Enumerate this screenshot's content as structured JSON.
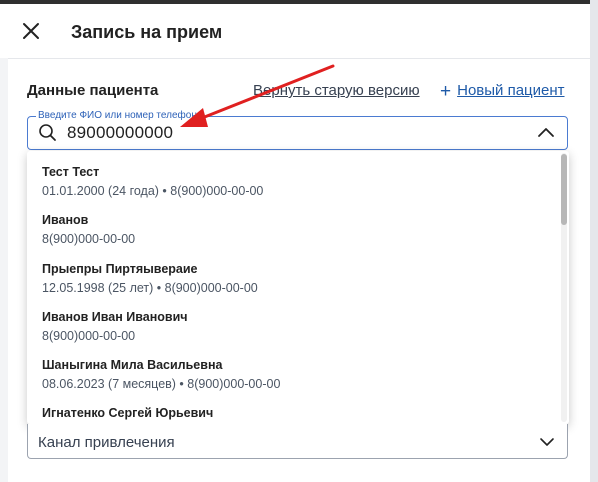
{
  "header": {
    "title": "Запись на прием"
  },
  "patient": {
    "section_title": "Данные пациента",
    "old_version_link": "Вернуть старую версию",
    "new_patient_plus": "+",
    "new_patient_link": "Новый пациент",
    "search": {
      "legend": "Введите ФИО или номер телефона",
      "value": "89000000000"
    }
  },
  "results": [
    {
      "name": "Тест Тест",
      "details": "01.01.2000 (24 года) • 8(900)000-00-00"
    },
    {
      "name": "Иванов",
      "details": "8(900)000-00-00"
    },
    {
      "name": "Прыепры Пиртяывераие",
      "details": "12.05.1998 (25 лет) • 8(900)000-00-00"
    },
    {
      "name": "Иванов Иван Иванович",
      "details": "8(900)000-00-00"
    },
    {
      "name": "Шаныгина Мила Васильевна",
      "details": "08.06.2023 (7 месяцев) • 8(900)000-00-00"
    },
    {
      "name": "Игнатенко Сергей Юрьевич",
      "details": ""
    }
  ],
  "acquisition_channel": {
    "label": "Канал привлечения"
  },
  "icons": {
    "close": "close-icon",
    "search": "search-icon",
    "collapse": "chevron-up-icon",
    "expand": "chevron-down-icon",
    "annotation": "arrow-annotation"
  },
  "colors": {
    "accent": "#1e5aa8",
    "annotation": "#e02020",
    "focus_border": "#4b7bd1"
  }
}
